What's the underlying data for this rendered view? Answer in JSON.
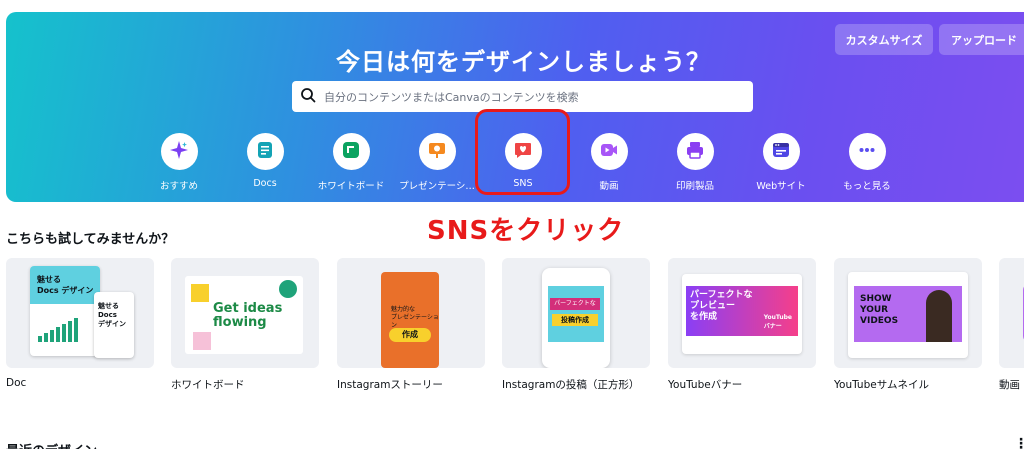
{
  "hero": {
    "title": "今日は何をデザインしましょう？",
    "custom_size_label": "カスタムサイズ",
    "upload_label": "アップロード",
    "search_placeholder": "自分のコンテンツまたはCanvaのコンテンツを検索"
  },
  "categories": [
    {
      "label": "おすすめ",
      "icon": "sparkle-icon",
      "color": "#7b3ff2"
    },
    {
      "label": "Docs",
      "icon": "doc-icon",
      "color": "#13a3b5"
    },
    {
      "label": "ホワイトボード",
      "icon": "whiteboard-icon",
      "color": "#0ba360"
    },
    {
      "label": "プレゼンテーシ…",
      "icon": "presentation-icon",
      "color": "#f5891f"
    },
    {
      "label": "SNS",
      "icon": "heart-chat-icon",
      "color": "#ef4444"
    },
    {
      "label": "動画",
      "icon": "video-icon",
      "color": "#a855f7"
    },
    {
      "label": "印刷製品",
      "icon": "printer-icon",
      "color": "#8b3ff2"
    },
    {
      "label": "Webサイト",
      "icon": "website-icon",
      "color": "#4f46e5"
    },
    {
      "label": "もっと見る",
      "icon": "more-icon",
      "color": "#5b4ef0"
    }
  ],
  "annotation": "SNSをクリック",
  "section_title": "こちらも試してみませんか？",
  "cards": [
    {
      "label": "Doc"
    },
    {
      "label": "ホワイトボード"
    },
    {
      "label": "Instagramストーリー"
    },
    {
      "label": "Instagramの投稿（正方形）"
    },
    {
      "label": "YouTubeバナー"
    },
    {
      "label": "YouTubeサムネイル"
    },
    {
      "label": "動画"
    }
  ],
  "thumbs": {
    "doc_title": "魅せる\nDocs デザイン",
    "doc_small": "魅せる\nDocs\nデザイン",
    "wb_text": "Get ideas\nflowing",
    "story_text": "魅力的な\nプレゼンテーション",
    "story_badge": "作成",
    "post_badge": "パーフェクトな",
    "post_badge2": "投稿作成",
    "yt_banner_text": "パーフェクトな\nプレビュー\nを作成",
    "yt_banner_tag": "YouTube\nバナー",
    "yt_thumb_text": "SHOW\nYOUR\nVIDEOS"
  },
  "recent_title": "最近のデザイン",
  "colors": {
    "annotation": "#e81a1a",
    "hero_start": "#15c2cc",
    "hero_end": "#7c4ef0"
  }
}
